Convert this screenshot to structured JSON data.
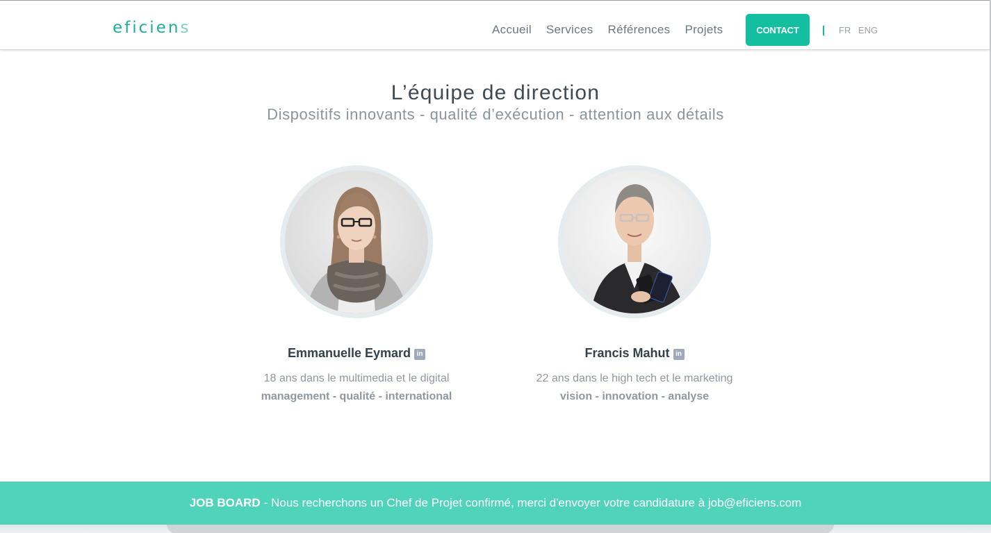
{
  "header": {
    "logo_main": "eficien",
    "logo_tail": "s",
    "nav": [
      "Accueil",
      "Services",
      "Références",
      "Projets"
    ],
    "contact_label": "CONTACT",
    "lang_fr": "FR",
    "lang_eng": "ENG",
    "accent_color": "#14bfa0"
  },
  "main": {
    "title": "L’équipe de direction",
    "subtitle": "Dispositifs innovants - qualité d’exécution - attention aux détails"
  },
  "team": [
    {
      "name": "Emmanuelle Eymard",
      "linkedin_icon": "linkedin-icon",
      "description": "18 ans dans le multimedia et le digital",
      "tags": "management - qualité - international"
    },
    {
      "name": "Francis Mahut",
      "linkedin_icon": "linkedin-icon",
      "description": "22 ans dans le high tech et le marketing",
      "tags": "vision - innovation - analyse"
    }
  ],
  "jobboard": {
    "label": "JOB BOARD",
    "text": "- Nous recherchons un Chef de Projet confirmé, merci d'envoyer votre candidature à job@eficiens.com",
    "background_color": "#4fd3bb"
  }
}
